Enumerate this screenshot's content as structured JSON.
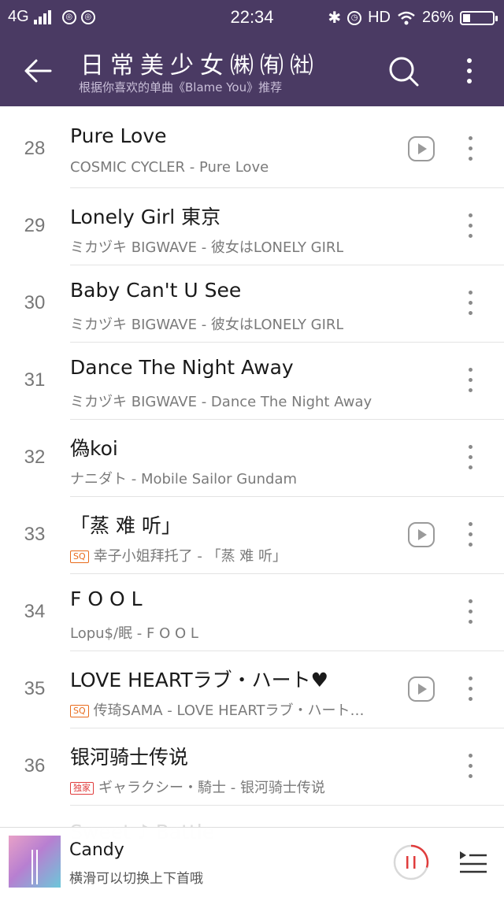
{
  "colors": {
    "header_bg": "#4a3a63",
    "accent": "#e03c3c",
    "sq_badge": "#e86b1c"
  },
  "status": {
    "network": "4G",
    "time": "22:34",
    "hd": "HD",
    "battery_percent": "26%",
    "battery_level": 0.26
  },
  "header": {
    "back_icon": "arrow-left-icon",
    "title": "日常美少女㈱㈲㈳",
    "subtitle": "根据你喜欢的单曲《Blame You》推荐",
    "search_icon": "search-icon",
    "more_icon": "more-vertical-icon"
  },
  "songs": [
    {
      "num": "28",
      "title": "Pure Love",
      "meta": "COSMIC CYCLER - Pure Love",
      "badge": "",
      "mv": true
    },
    {
      "num": "29",
      "title": "Lonely Girl 東京",
      "meta": "ミカヅキ BIGWAVE - 彼女はLONELY GIRL",
      "badge": "",
      "mv": false
    },
    {
      "num": "30",
      "title": "Baby Can't U See",
      "meta": "ミカヅキ BIGWAVE - 彼女はLONELY GIRL",
      "badge": "",
      "mv": false
    },
    {
      "num": "31",
      "title": "Dance The Night Away",
      "meta": "ミカヅキ BIGWAVE - Dance The Night Away",
      "badge": "",
      "mv": false
    },
    {
      "num": "32",
      "title": "偽koi",
      "meta": "ナニダト - Mobile Sailor Gundam",
      "badge": "",
      "mv": false
    },
    {
      "num": "33",
      "title": "「蒸 难 听」",
      "meta": "幸子小姐拜托了 - 「蒸 难 听」",
      "badge": "SQ",
      "mv": true
    },
    {
      "num": "34",
      "title": "F O O L",
      "meta": "Lopu$/眠 - F O O L",
      "badge": "",
      "mv": false
    },
    {
      "num": "35",
      "title": "LOVE HEARTラブ・ハート♥",
      "meta": "传琦SAMA - LOVE HEARTラブ・ハート…",
      "badge": "SQ",
      "mv": true
    },
    {
      "num": "36",
      "title": "银河骑士传说",
      "meta": "ギャラクシー・騎士 - 银河骑士传说",
      "badge": "独家",
      "mv": false
    }
  ],
  "peek_title": "Sweet ♪ Battle",
  "player": {
    "title": "Candy",
    "hint": "横滑可以切换上下首哦",
    "pause_icon": "pause-icon",
    "queue_icon": "playlist-icon",
    "progress": 0.3
  }
}
